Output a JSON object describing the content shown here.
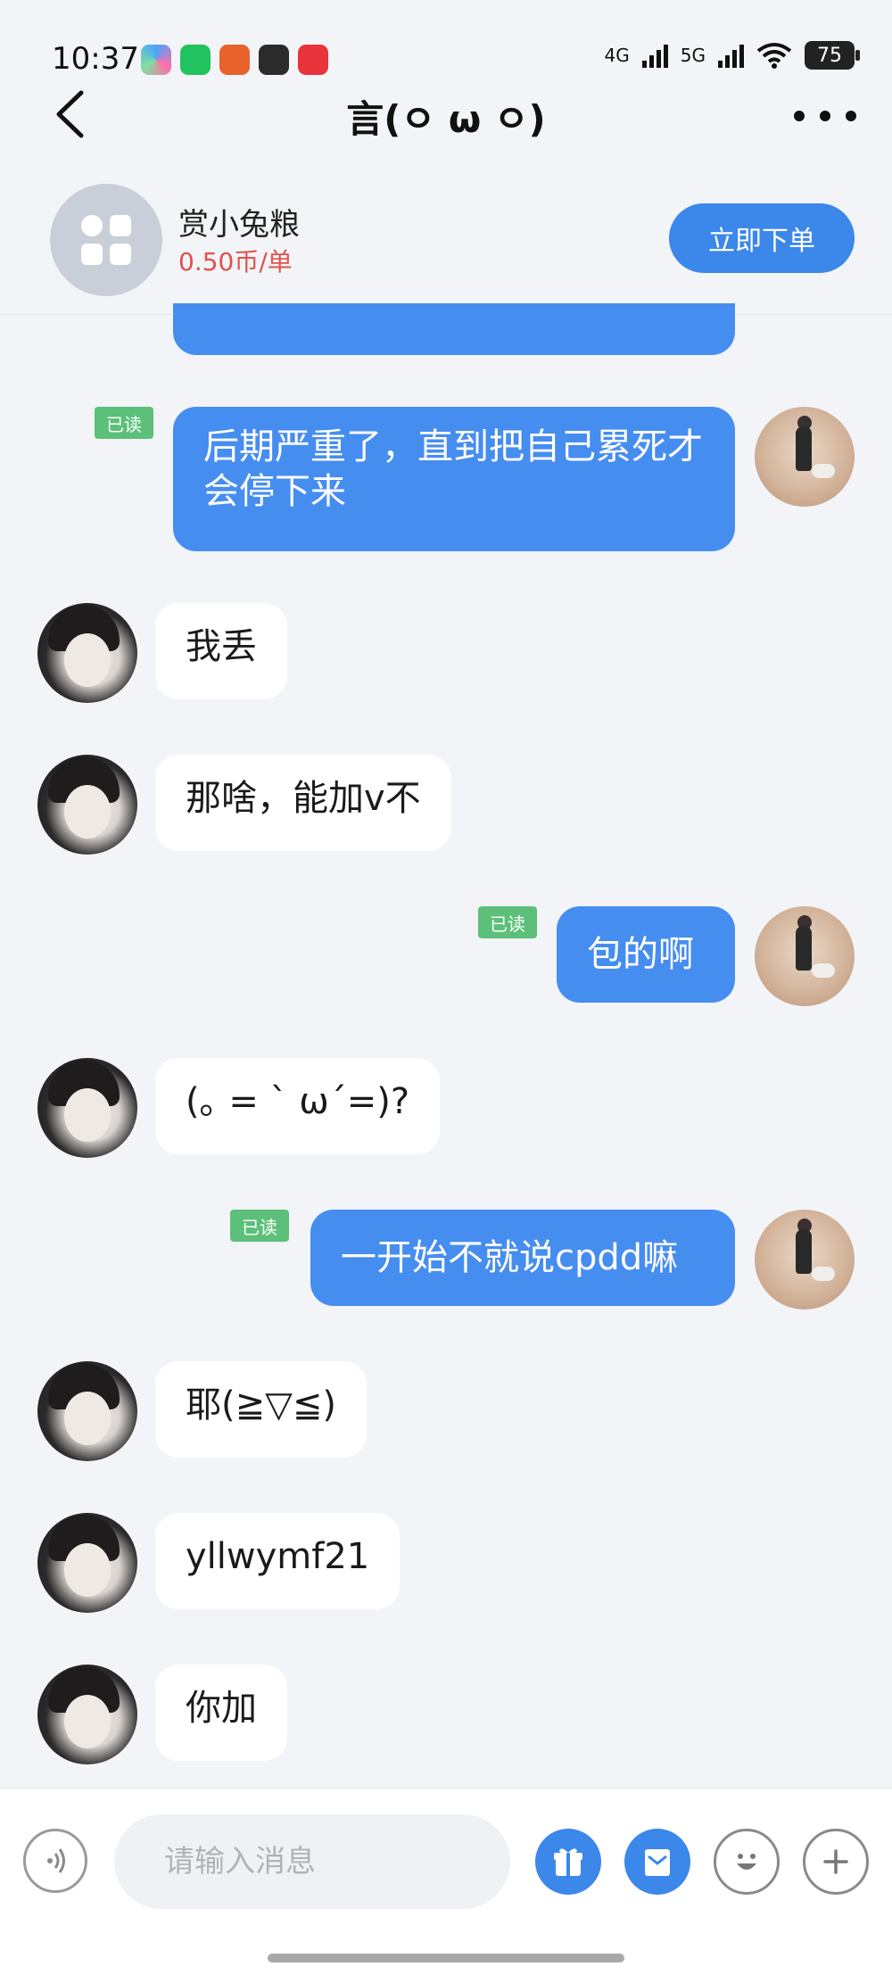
{
  "status_bar": {
    "time": "10:37",
    "battery": "75",
    "net1": "4G",
    "net2": "5G"
  },
  "nav": {
    "title": "言(ㅇ ω ㅇ)"
  },
  "service": {
    "name": "赏小兔粮",
    "price": "0.50币/单",
    "order_label": "立即下单"
  },
  "read_label": "已读",
  "messages": [
    {
      "side": "out",
      "text": "后期严重了，直到把自己累死才会停下来",
      "read": true
    },
    {
      "side": "in",
      "text": "我丢"
    },
    {
      "side": "in",
      "text": "那啥，能加v不"
    },
    {
      "side": "out",
      "text": "包的啊",
      "read": true
    },
    {
      "side": "in",
      "text": "(｡ = ` ω´=)?"
    },
    {
      "side": "out",
      "text": "一开始不就说cpdd嘛",
      "read": true
    },
    {
      "side": "in",
      "text": "耶(≧▽≦)"
    },
    {
      "side": "in",
      "text": "yllwymf21"
    },
    {
      "side": "in",
      "text": "你加"
    }
  ],
  "input": {
    "placeholder": "请输入消息"
  },
  "colors": {
    "accent": "#468df0",
    "read_badge": "#5cc07a",
    "price": "#e0524a"
  }
}
